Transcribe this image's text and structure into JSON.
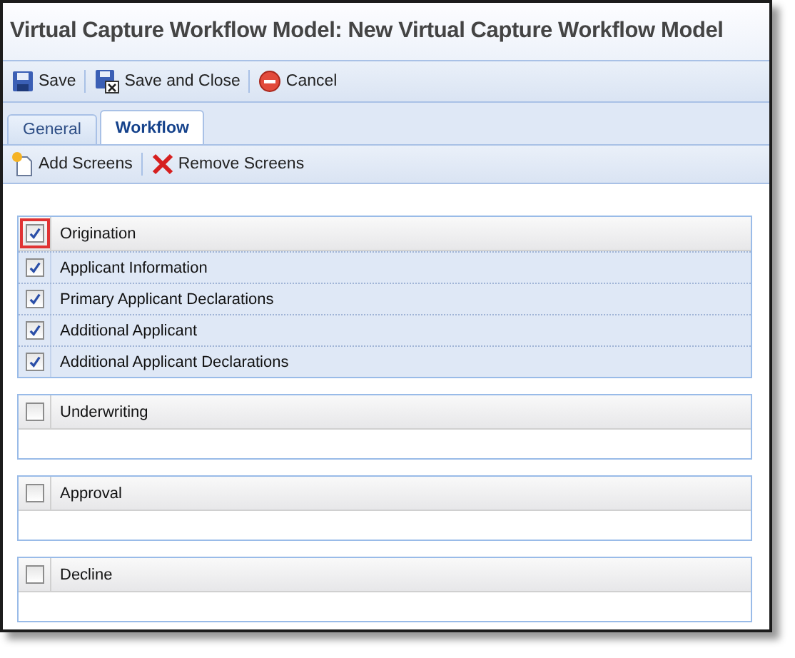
{
  "window": {
    "title": "Virtual Capture Workflow Model: New Virtual Capture Workflow Model"
  },
  "toolbar": [
    {
      "label": "Save",
      "kind": "save"
    },
    {
      "label": "Save and Close",
      "kind": "save-close"
    },
    {
      "label": "Cancel",
      "kind": "cancel"
    }
  ],
  "tabs": [
    {
      "label": "General",
      "selected": false
    },
    {
      "label": "Workflow",
      "selected": true
    }
  ],
  "screens_toolbar": [
    {
      "label": "Add Screens",
      "kind": "add"
    },
    {
      "label": "Remove Screens",
      "kind": "remove"
    }
  ],
  "groups": [
    {
      "name": "Origination",
      "checked": true,
      "highlighted": true,
      "screens": [
        {
          "name": "Applicant Information",
          "checked": true
        },
        {
          "name": "Primary Applicant Declarations",
          "checked": true
        },
        {
          "name": "Additional Applicant",
          "checked": true
        },
        {
          "name": "Additional Applicant Declarations",
          "checked": true
        }
      ]
    },
    {
      "name": "Underwriting",
      "checked": false,
      "highlighted": false
    },
    {
      "name": "Approval",
      "checked": false,
      "highlighted": false
    },
    {
      "name": "Decline",
      "checked": false,
      "highlighted": false
    }
  ]
}
